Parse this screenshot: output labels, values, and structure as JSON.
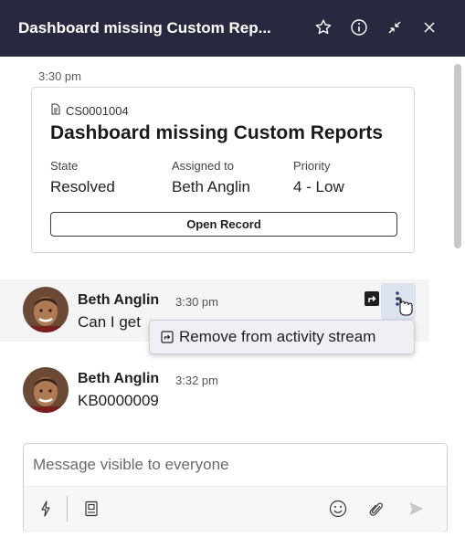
{
  "header": {
    "title": "Dashboard missing Custom Rep...",
    "icons": [
      "star-icon",
      "info-icon",
      "minimize-icon",
      "close-icon"
    ]
  },
  "stream": {
    "record_card": {
      "timestamp": "3:30 pm",
      "number": "CS0001004",
      "title": "Dashboard missing Custom Reports",
      "fields": [
        {
          "label": "State",
          "value": "Resolved"
        },
        {
          "label": "Assigned to",
          "value": "Beth Anglin"
        },
        {
          "label": "Priority",
          "value": "4 - Low"
        }
      ],
      "open_button": "Open Record"
    },
    "messages": [
      {
        "author": "Beth Anglin",
        "time": "3:30 pm",
        "text": "Can I get"
      },
      {
        "author": "Beth Anglin",
        "time": "3:32 pm",
        "text": "KB0000009"
      }
    ],
    "context_menu": {
      "item": "Remove from activity stream"
    }
  },
  "composer": {
    "placeholder": "Message visible to everyone",
    "tools": [
      "quick-action-icon",
      "knowledge-icon",
      "emoji-icon",
      "attach-icon",
      "send-icon"
    ]
  },
  "colors": {
    "header_bg": "#28293e",
    "hover_row": "#f4f4f4",
    "menu_bg": "#eef0f6"
  }
}
